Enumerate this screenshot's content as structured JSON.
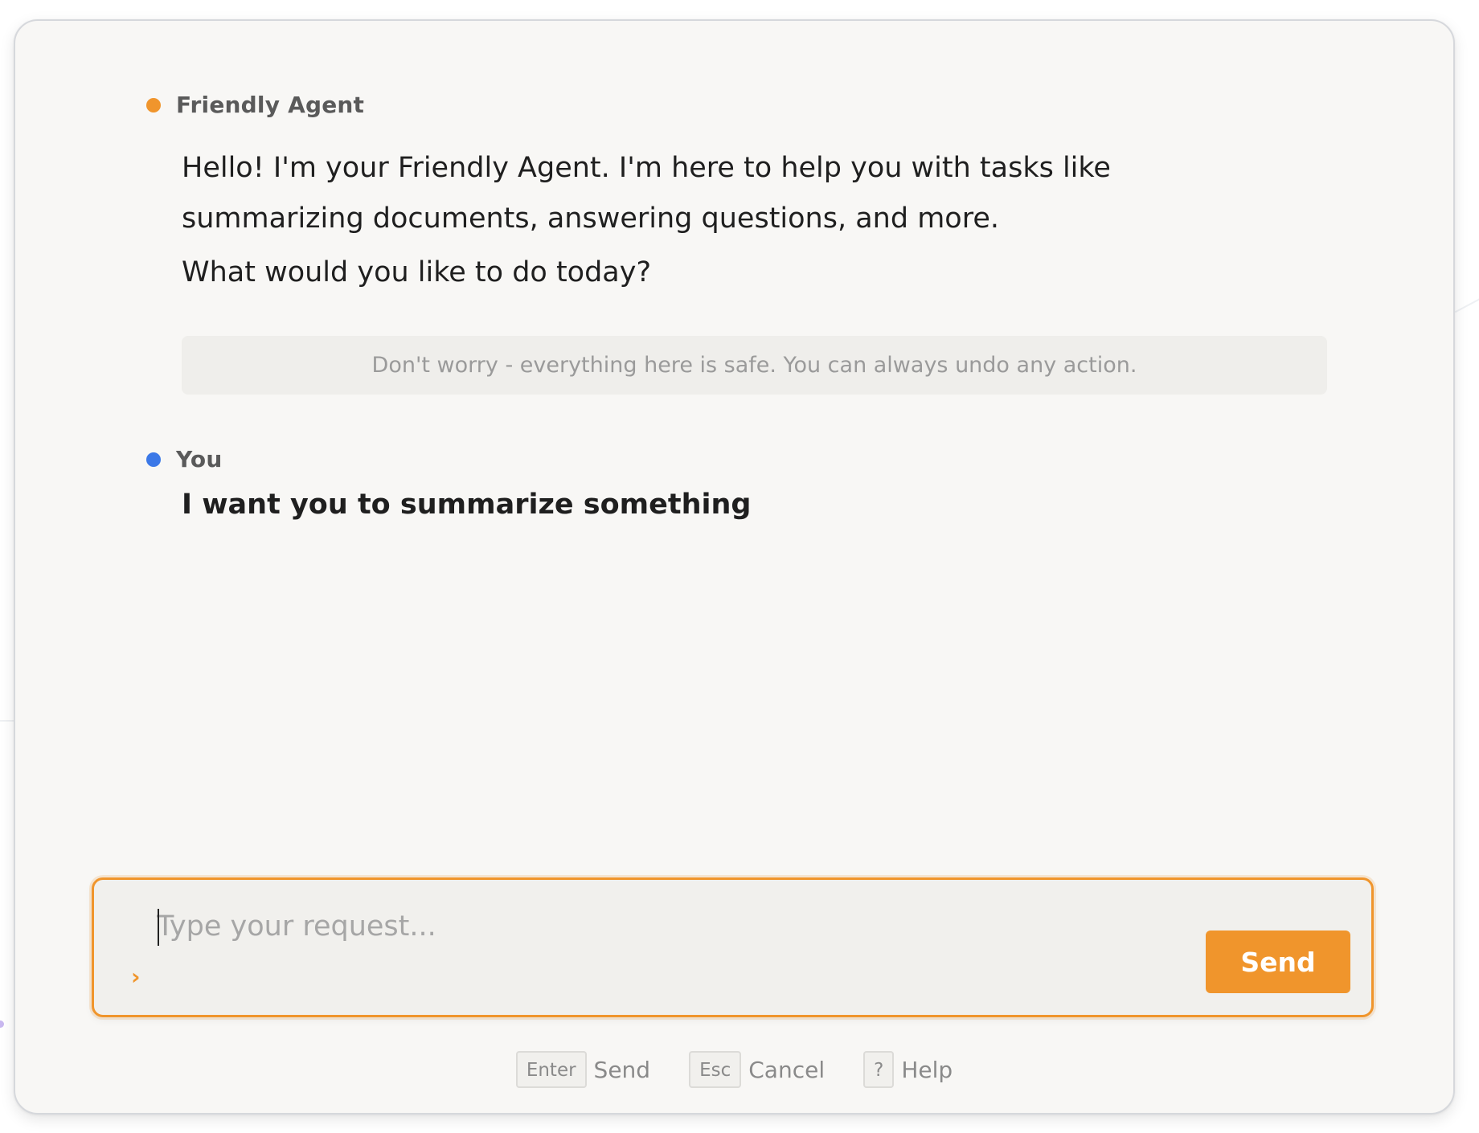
{
  "agent": {
    "name": "Friendly Agent",
    "dot_color": "#f0952c",
    "message_paragraphs": [
      "Hello! I'm your Friendly Agent. I'm here to help you with tasks like summarizing documents, answering questions, and more.",
      "What would you like to do today?"
    ]
  },
  "notice": {
    "text": "Don't worry - everything here is safe. You can always undo any action."
  },
  "user": {
    "name": "You",
    "dot_color": "#3b78e7",
    "message": "I want you to summarize something"
  },
  "composer": {
    "prompt_icon": "chevron-right-icon",
    "prompt_glyph": "›",
    "placeholder": "Type your request...",
    "value": "",
    "send_label": "Send",
    "accent_color": "#f0952c"
  },
  "shortcuts": [
    {
      "key": "Enter",
      "label": "Send"
    },
    {
      "key": "Esc",
      "label": "Cancel"
    },
    {
      "key": "?",
      "label": "Help"
    }
  ]
}
